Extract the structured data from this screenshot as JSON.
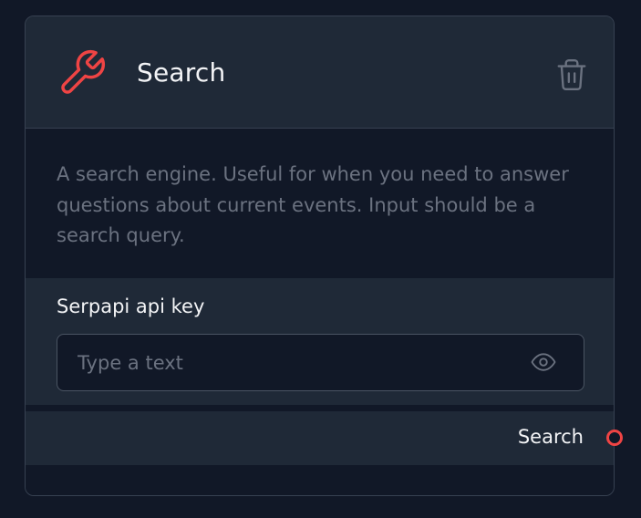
{
  "node": {
    "icon": "wrench-icon",
    "title": "Search",
    "delete_icon": "trash-icon",
    "description": "A search engine. Useful for when you need to answer questions about current events. Input should be a search query.",
    "params": [
      {
        "label": "Serpapi api key",
        "value": "",
        "placeholder": "Type a text",
        "toggle_icon": "eye-icon"
      }
    ],
    "output": {
      "label": "Search",
      "handle_icon": "output-handle"
    }
  },
  "colors": {
    "background": "#111827",
    "card": "#1f2937",
    "border": "#374151",
    "text": "#f3f4f6",
    "muted_text": "#6b7280",
    "accent": "#ef4444"
  }
}
